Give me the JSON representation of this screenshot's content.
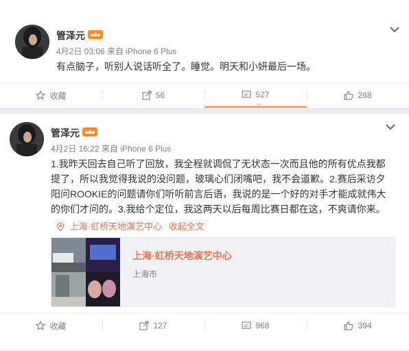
{
  "colors": {
    "accent": "#eb7350",
    "muted": "#808080",
    "text": "#333333",
    "highlight": "#ff8140"
  },
  "posts": [
    {
      "username": "管泽元",
      "meta": "4月2日 03:06 来自 iPhone 6 Plus",
      "text": "有点脑子，听别人说话听全了。睡觉。明天和小妍最后一场。",
      "actions": {
        "favorite": "收藏",
        "repost": "56",
        "comment": "527",
        "like": "268"
      }
    },
    {
      "username": "管泽元",
      "meta": "4月2日 16:22 来自 iPhone 6 Plus",
      "lines": [
        "1.我昨天回去自己听了回放，我全程就调侃了无状态一次而且他的所有优点我都",
        "提了，所以我觉得我说的没问题，玻璃心们闭嘴吧，我不会道歉。2.赛后采访夕",
        "阳问ROOKIE的问题请你们听听前言后语，我说的是一个好的对手才能成就伟大",
        "的你们才问的。3.我给个定位，我这两天以后每周比赛日都在这，不爽请你来。"
      ],
      "location": "上海·虹桥天地演艺中心",
      "collapse": "收起全文",
      "place": {
        "name": "上海·虹桥天地演艺中心",
        "city": "上海市"
      },
      "actions": {
        "favorite": "收藏",
        "repost": "127",
        "comment": "968",
        "like": "394"
      }
    }
  ],
  "icons": {
    "avatar": "avatar",
    "vip": "vip-crown-icon",
    "chevron": "chevron-down-icon",
    "favorite": "star-icon",
    "repost": "repost-icon",
    "comment": "comment-icon",
    "like": "thumbs-up-icon",
    "pin": "location-pin-icon"
  }
}
